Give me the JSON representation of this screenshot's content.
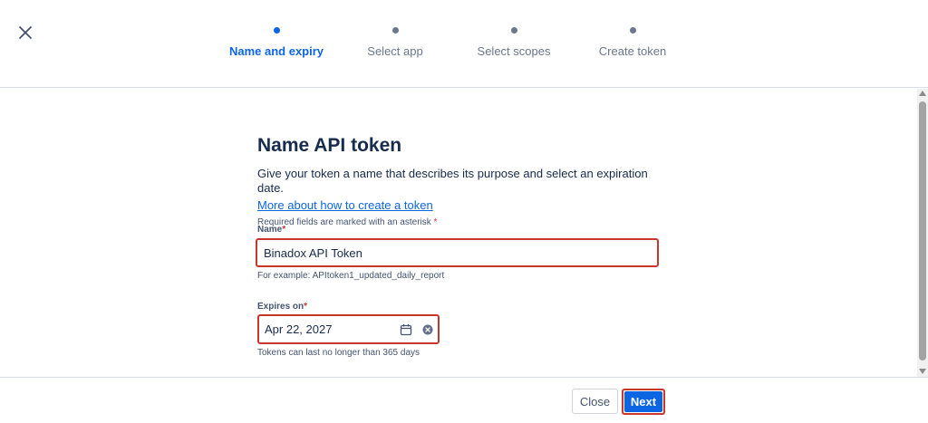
{
  "stepper": {
    "steps": [
      {
        "label": "Name and expiry",
        "active": true
      },
      {
        "label": "Select app",
        "active": false
      },
      {
        "label": "Select scopes",
        "active": false
      },
      {
        "label": "Create token",
        "active": false
      }
    ]
  },
  "form": {
    "title": "Name API token",
    "description": "Give your token a name that describes its purpose and select an expiration date.",
    "help_link": "More about how to create a token",
    "required_note": "Required fields are marked with an asterisk",
    "asterisk": "*",
    "name": {
      "label": "Name",
      "value": "Binadox API Token",
      "help": "For example: APItoken1_updated_daily_report"
    },
    "expires": {
      "label": "Expires on",
      "value": "Apr 22, 2027",
      "help": "Tokens can last no longer than 365 days"
    }
  },
  "footer": {
    "close_label": "Close",
    "next_label": "Next"
  },
  "icons": {
    "close": "close-icon",
    "calendar": "calendar-icon",
    "clear": "clear-icon"
  },
  "colors": {
    "accent": "#0c66e4",
    "highlight": "#c9372c",
    "text": "#172b4d"
  }
}
